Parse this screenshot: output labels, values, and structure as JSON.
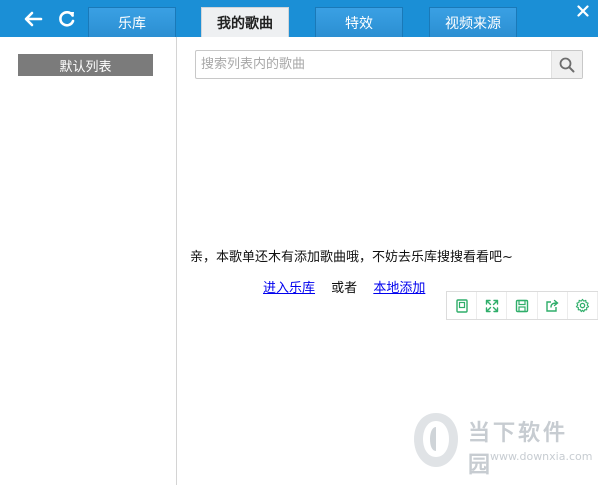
{
  "tabs": [
    {
      "label": "乐库",
      "active": false
    },
    {
      "label": "我的歌曲",
      "active": true
    },
    {
      "label": "特效",
      "active": false
    },
    {
      "label": "视频来源",
      "active": false
    }
  ],
  "sidebar": {
    "default_list_label": "默认列表"
  },
  "search": {
    "placeholder": "搜索列表内的歌曲",
    "value": ""
  },
  "empty_state": {
    "message": "亲，本歌单还木有添加歌曲哦，不妨去乐库搜搜看看吧~",
    "enter_library_link": "进入乐库",
    "or_text": "或者",
    "local_add_link": "本地添加"
  },
  "mini_toolbar": [
    "mini-mode-icon",
    "fullscreen-icon",
    "save-icon",
    "share-icon",
    "settings-icon"
  ],
  "watermark": {
    "brand_text": "当下软件园",
    "url_text": "www.downxia.com"
  },
  "colors": {
    "topbar": "#1b8fd6",
    "link": "#0000ee",
    "toolbar_icon": "#2fae6a"
  }
}
